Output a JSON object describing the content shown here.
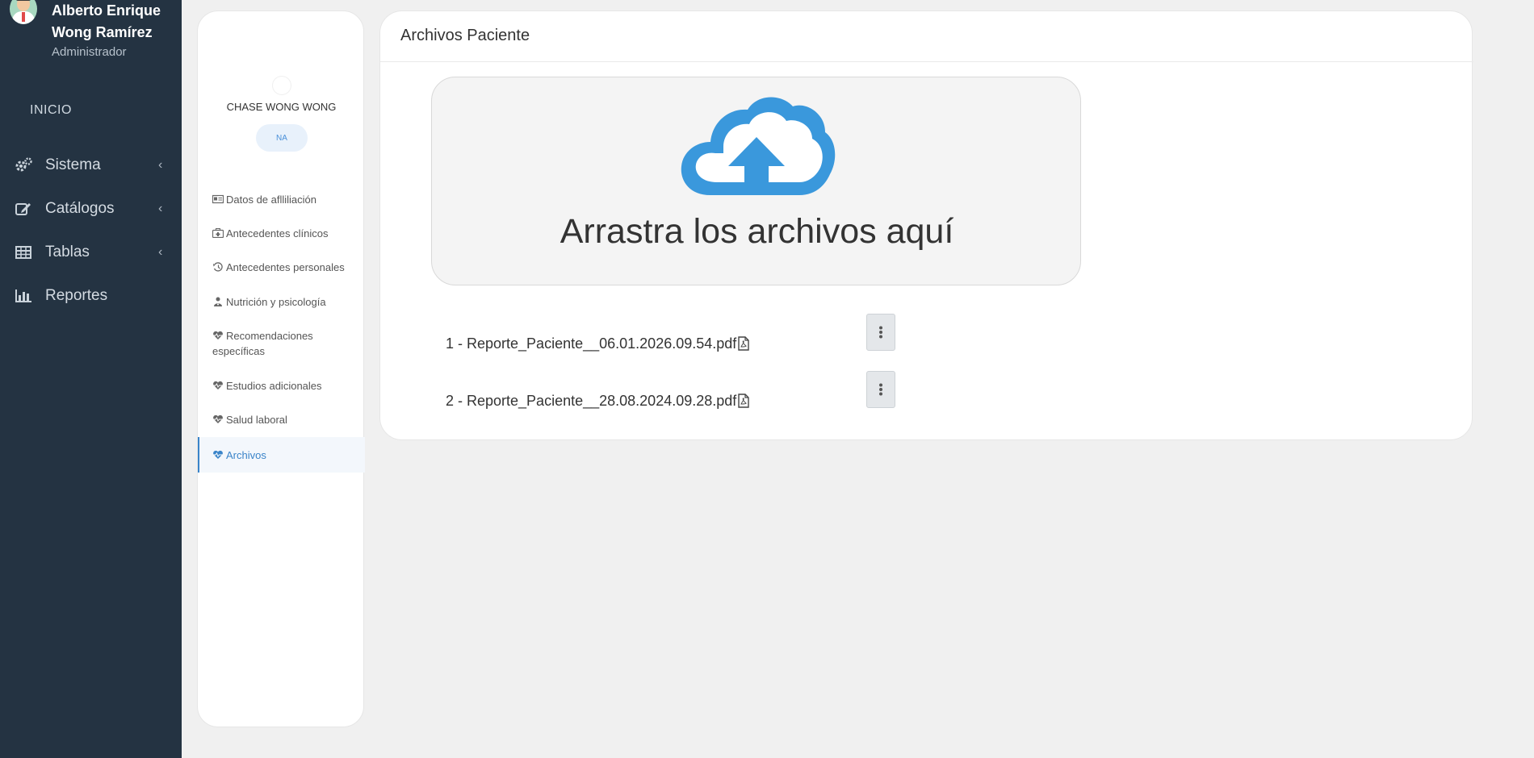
{
  "user": {
    "name": "Alberto Enrique Wong Ramírez",
    "role": "Administrador"
  },
  "nav": {
    "home": "INICIO",
    "items": [
      {
        "label": "Sistema",
        "icon": "gears-icon",
        "expandable": true
      },
      {
        "label": "Catálogos",
        "icon": "edit-icon",
        "expandable": true
      },
      {
        "label": "Tablas",
        "icon": "table-icon",
        "expandable": true
      },
      {
        "label": "Reportes",
        "icon": "bar-chart-icon",
        "expandable": false
      }
    ]
  },
  "patient": {
    "name": "CHASE WONG WONG",
    "badge": "NA",
    "menu": [
      {
        "label": "Datos de aflliliación",
        "icon": "id-card-icon"
      },
      {
        "label": "Antecedentes clínicos",
        "icon": "medkit-icon"
      },
      {
        "label": "Antecedentes personales",
        "icon": "history-icon"
      },
      {
        "label": "Nutrición y psicología",
        "icon": "user-md-icon"
      },
      {
        "label": "Recomendaciones específicas",
        "icon": "heartbeat-icon"
      },
      {
        "label": "Estudios adicionales",
        "icon": "heartbeat-icon"
      },
      {
        "label": "Salud laboral",
        "icon": "heartbeat-icon"
      },
      {
        "label": "Archivos",
        "icon": "heartbeat-icon",
        "active": true
      }
    ]
  },
  "main": {
    "title": "Archivos Paciente",
    "dropzone_text": "Arrastra los archivos aquí",
    "files": [
      {
        "name": "1 - Reporte_Paciente__06.01.2026.09.54.pdf"
      },
      {
        "name": "2 - Reporte_Paciente__28.08.2024.09.28.pdf"
      }
    ]
  },
  "colors": {
    "sidebar_bg": "#243342",
    "accent": "#3a98dc",
    "page_bg": "#f0f0f0"
  }
}
